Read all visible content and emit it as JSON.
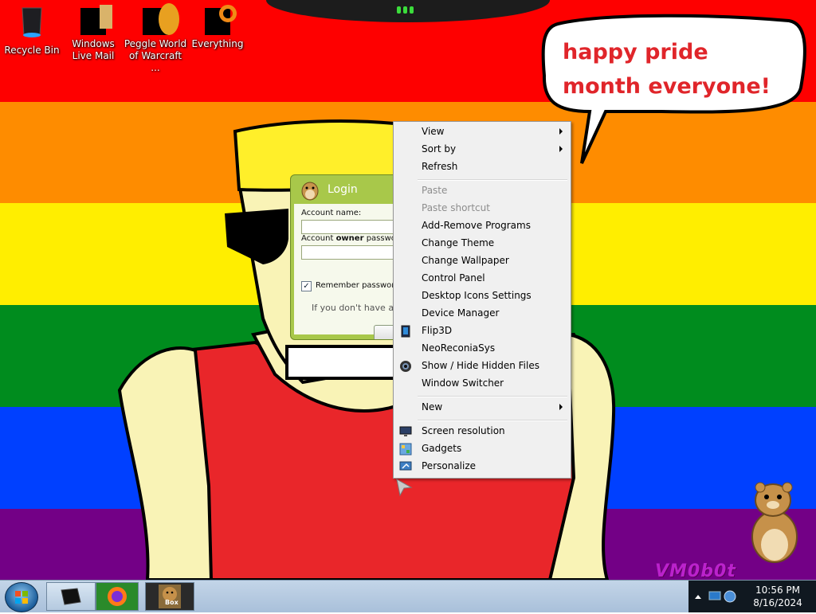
{
  "desktop": {
    "icons": [
      {
        "label": "Recycle Bin",
        "icon": "recycle-bin-icon"
      },
      {
        "label": "Windows Live Mail",
        "icon": "mail-icon"
      },
      {
        "label": "Peggle World of Warcraft ...",
        "icon": "peggle-icon"
      },
      {
        "label": "Everything",
        "icon": "everything-icon"
      }
    ],
    "speech_bubble": "happy pride month everyone!",
    "watermark": "VM0b0t"
  },
  "login": {
    "title": "Login",
    "account_label": "Account name:",
    "owner_label_pre": "Account ",
    "owner_label_bold": "owner",
    "owner_label_post": " password",
    "remember_label": "Remember password",
    "remember_checked": true,
    "info_text": "If you don't have an a"
  },
  "context_menu": {
    "items": [
      {
        "label": "View",
        "submenu": true,
        "disabled": false
      },
      {
        "label": "Sort by",
        "submenu": true,
        "disabled": false
      },
      {
        "label": "Refresh",
        "submenu": false,
        "disabled": false
      },
      {
        "label": "Paste",
        "submenu": false,
        "disabled": true
      },
      {
        "label": "Paste shortcut",
        "submenu": false,
        "disabled": true
      },
      {
        "label": "Add-Remove Programs",
        "submenu": false,
        "disabled": false
      },
      {
        "label": "Change Theme",
        "submenu": false,
        "disabled": false
      },
      {
        "label": "Change Wallpaper",
        "submenu": false,
        "disabled": false
      },
      {
        "label": "Control Panel",
        "submenu": false,
        "disabled": false
      },
      {
        "label": "Desktop Icons Settings",
        "submenu": false,
        "disabled": false
      },
      {
        "label": "Device Manager",
        "submenu": false,
        "disabled": false
      },
      {
        "label": "Flip3D",
        "submenu": false,
        "disabled": false,
        "icon": "flip3d-icon"
      },
      {
        "label": "NeoReconiaSys",
        "submenu": false,
        "disabled": false
      },
      {
        "label": "Show / Hide Hidden Files",
        "submenu": false,
        "disabled": false,
        "icon": "hidden-files-icon"
      },
      {
        "label": "Window Switcher",
        "submenu": false,
        "disabled": false
      },
      {
        "label": "New",
        "submenu": true,
        "disabled": false
      },
      {
        "label": "Screen resolution",
        "submenu": false,
        "disabled": false,
        "icon": "monitor-icon"
      },
      {
        "label": "Gadgets",
        "submenu": false,
        "disabled": false,
        "icon": "gadgets-icon"
      },
      {
        "label": "Personalize",
        "submenu": false,
        "disabled": false,
        "icon": "personalize-icon"
      }
    ]
  },
  "taskbar": {
    "pinned": [
      "show-desktop-icon",
      "firefox-icon",
      "box-app-icon"
    ],
    "box_label": "Box",
    "clock_time": "10:56 PM",
    "clock_date": "8/16/2024"
  },
  "colors": {
    "rainbow": [
      "#fe0000",
      "#fe8c00",
      "#ffee00",
      "#008c1e",
      "#0040ff",
      "#730086"
    ],
    "bubble_text": "#e0252a",
    "login_accent": "#a8c84a",
    "skin": "#f9f3b6",
    "hat": "#ffef2a",
    "shirt": "#e9262a"
  }
}
